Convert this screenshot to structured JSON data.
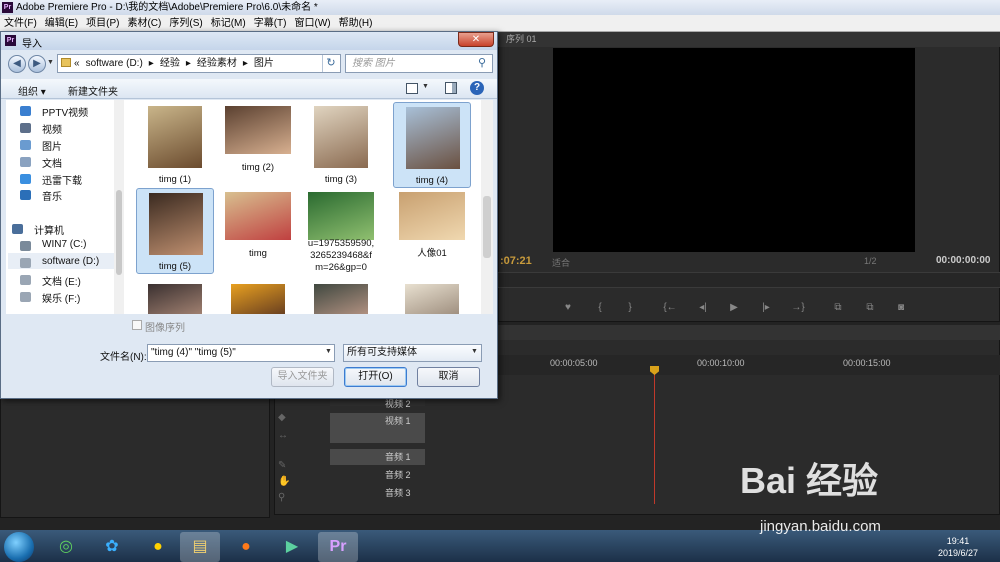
{
  "app": {
    "title": "Adobe Premiere Pro - D:\\我的文档\\Adobe\\Premiere Pro\\6.0\\未命名 *",
    "logo": "Pr",
    "menu": [
      "文件(F)",
      "编辑(E)",
      "项目(P)",
      "素材(C)",
      "序列(S)",
      "标记(M)",
      "字幕(T)",
      "窗口(W)",
      "帮助(H)"
    ]
  },
  "monitor": {
    "tab": "序列 01",
    "time_left": ":07:21",
    "fit": "适合",
    "ratio": "1/2",
    "time_right": "00:00:00:00"
  },
  "timeline": {
    "ruler": [
      "00:00:05:00",
      "00:00:10:00",
      "00:00:15:00"
    ],
    "tracks": [
      {
        "label": "视频 2"
      },
      {
        "label": "视频 1"
      },
      {
        "label": "音频 1"
      },
      {
        "label": "音频 2"
      },
      {
        "label": "音频 3"
      }
    ],
    "playhead_fraction": 0.35
  },
  "dialog": {
    "title": "导入",
    "icon": "Pr",
    "close": "✕",
    "address": [
      "«",
      "software (D:)",
      "▸",
      "经验",
      "▸",
      "经验素材",
      "▸",
      "图片"
    ],
    "search_placeholder": "搜索 图片",
    "organize": "组织 ▾",
    "new_folder": "新建文件夹",
    "help": "?",
    "nav": [
      {
        "label": "PPTV视频",
        "color": "#3a7fd0"
      },
      {
        "label": "视频",
        "color": "#5d6f8a"
      },
      {
        "label": "图片",
        "color": "#6a9bd0"
      },
      {
        "label": "文档",
        "color": "#8aa2c0"
      },
      {
        "label": "迅雷下载",
        "color": "#3a8fe0"
      },
      {
        "label": "音乐",
        "color": "#2b6fb8"
      },
      {
        "label": "计算机",
        "color": "#4a6e9a"
      },
      {
        "label": "WIN7 (C:)",
        "color": "#7a8a9a"
      },
      {
        "label": "software (D:)",
        "color": "#9aa6b4"
      },
      {
        "label": "文档 (E:)",
        "color": "#9aa6b4"
      },
      {
        "label": "娱乐 (F:)",
        "color": "#9aa6b4"
      }
    ],
    "files": [
      {
        "name": "timg (1)",
        "colors": [
          "#c9b58a",
          "#6b4b2e"
        ],
        "selected": false
      },
      {
        "name": "timg (2)",
        "colors": [
          "#5a4030",
          "#d8b090"
        ],
        "selected": false
      },
      {
        "name": "timg (3)",
        "colors": [
          "#e0d4c0",
          "#8a6a50"
        ],
        "selected": false
      },
      {
        "name": "timg (4)",
        "colors": [
          "#a8c0d8",
          "#6a5040"
        ],
        "selected": true
      },
      {
        "name": "timg (5)",
        "colors": [
          "#3a2a20",
          "#c09070"
        ],
        "selected": true
      },
      {
        "name": "timg",
        "colors": [
          "#d8c090",
          "#c04040"
        ],
        "selected": false
      },
      {
        "name": "u=1975359590,3265239468&fm=26&gp=0",
        "name_lines": [
          "u=1975359590,",
          "3265239468&f",
          "m=26&gp=0"
        ],
        "colors": [
          "#2a6a30",
          "#90c070"
        ],
        "selected": false
      },
      {
        "name": "人像01",
        "colors": [
          "#c8a070",
          "#f0d8b0"
        ],
        "selected": false
      },
      {
        "name": "",
        "colors": [
          "#3a3030",
          "#a08070"
        ],
        "selected": false
      },
      {
        "name": "",
        "colors": [
          "#e8a020",
          "#6a4020"
        ],
        "selected": false
      },
      {
        "name": "",
        "colors": [
          "#404840",
          "#b09080"
        ],
        "selected": false
      },
      {
        "name": "",
        "colors": [
          "#e8e0d0",
          "#a09080"
        ],
        "selected": false
      }
    ],
    "image_sequence": "图像序列",
    "filename_label": "文件名(N):",
    "filename_value": "\"timg (4)\" \"timg (5)\"",
    "filter": "所有可支持媒体",
    "btn_import_folder": "导入文件夹",
    "btn_open": "打开(O)",
    "btn_cancel": "取消"
  },
  "taskbar": {
    "time": "19:41",
    "date": "2019/6/27"
  },
  "watermark": {
    "text": "Bai 经验",
    "url": "jingyan.baidu.com"
  },
  "colors": {
    "selection": "#cce3f7",
    "playhead": "#c0392b",
    "timecode": "#c89b3c"
  }
}
